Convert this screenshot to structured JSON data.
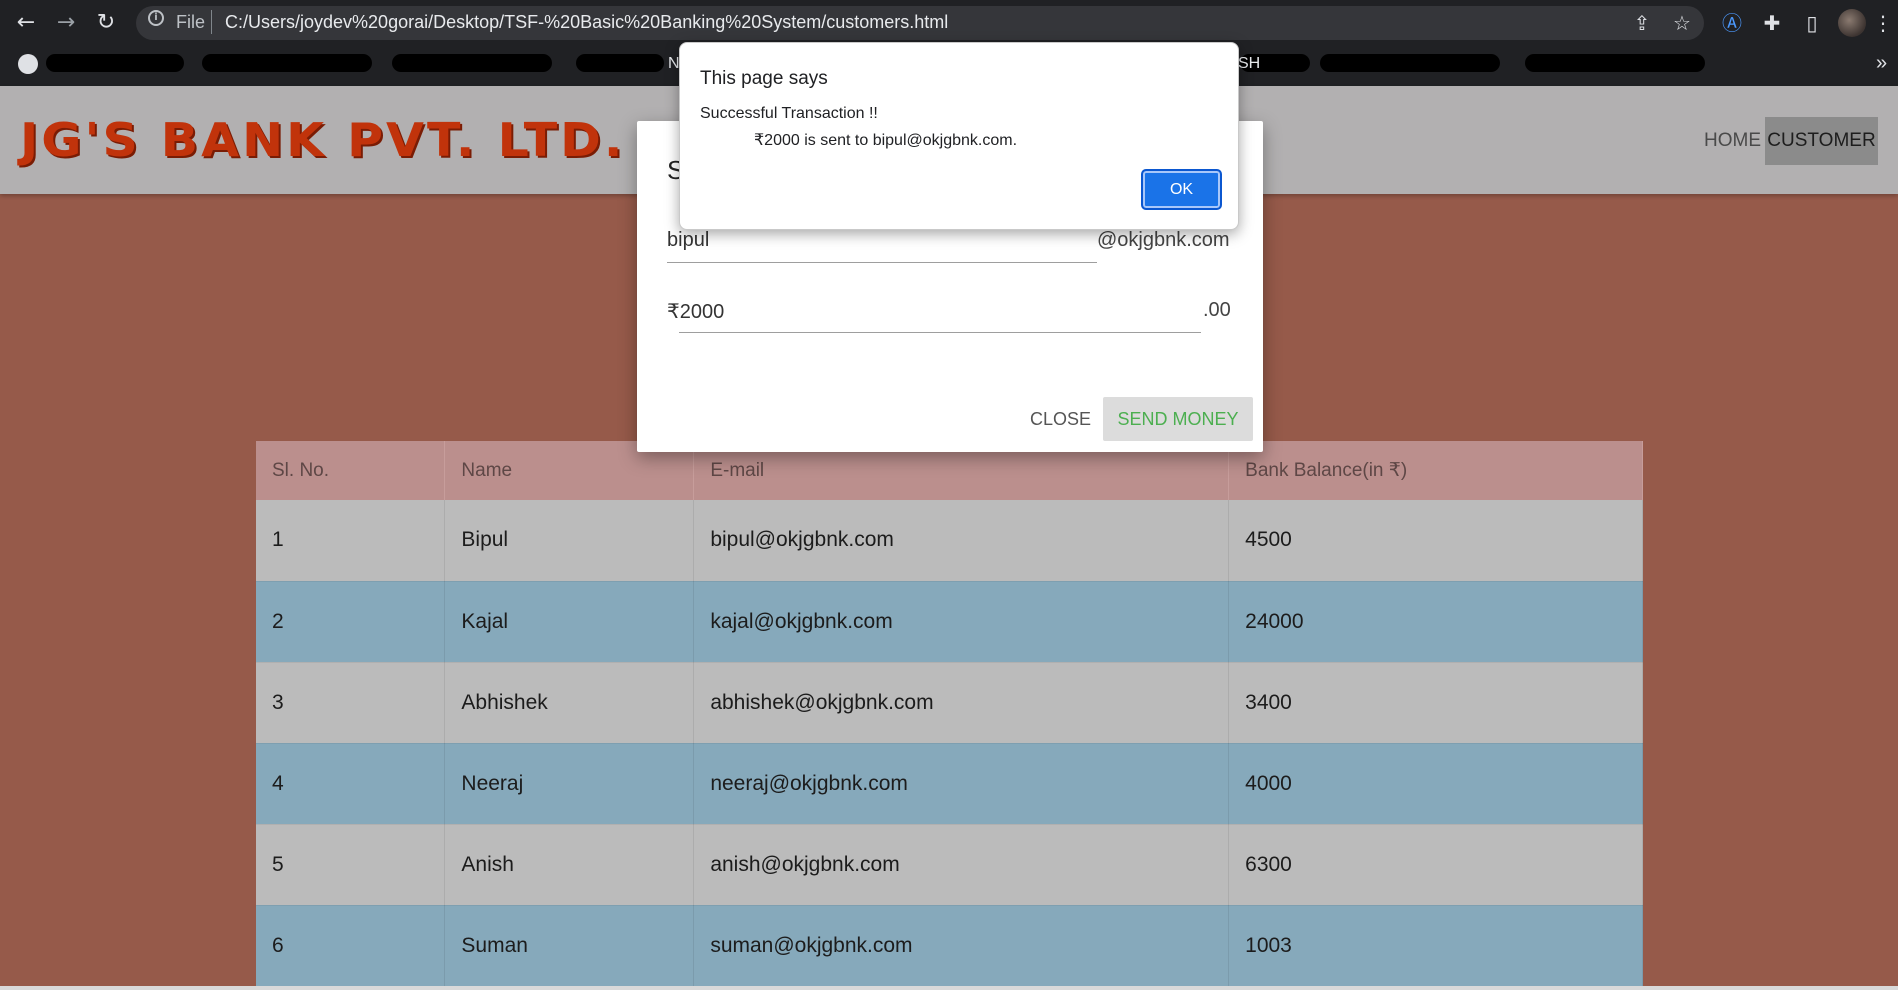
{
  "browser": {
    "file_label": "File",
    "url": "C:/Users/joydev%20gorai/Desktop/TSF-%20Basic%20Banking%20System/customers.html",
    "bookmark_visible_fragments": [
      "N",
      "SH"
    ],
    "more_bookmarks": "»"
  },
  "site": {
    "logo_text": "JG'S BANK PVT. LTD.",
    "nav": {
      "home": "HOME",
      "customer": "CUSTOMER"
    }
  },
  "modal": {
    "title_visible": "S",
    "receiver_value": "bipul",
    "receiver_suffix": "@okjgbnk.com",
    "amount_value": "₹2000",
    "amount_suffix": ".00",
    "close_label": "CLOSE",
    "send_label": "SEND MONEY"
  },
  "alert": {
    "title": "This page says",
    "line1": "Successful Transaction !!",
    "line2": "₹2000 is sent to bipul@okjgbnk.com.",
    "ok_label": "OK"
  },
  "table": {
    "headers": [
      "Sl. No.",
      "Name",
      "E-mail",
      "Bank Balance(in ₹)"
    ],
    "rows": [
      [
        "1",
        "Bipul",
        "bipul@okjgbnk.com",
        "4500"
      ],
      [
        "2",
        "Kajal",
        "kajal@okjgbnk.com",
        "24000"
      ],
      [
        "3",
        "Abhishek",
        "abhishek@okjgbnk.com",
        "3400"
      ],
      [
        "4",
        "Neeraj",
        "neeraj@okjgbnk.com",
        "4000"
      ],
      [
        "5",
        "Anish",
        "anish@okjgbnk.com",
        "6300"
      ],
      [
        "6",
        "Suman",
        "suman@okjgbnk.com",
        "1003"
      ]
    ]
  },
  "colors": {
    "page_bg": "#965a4a",
    "header_bg": "#b2b0b1",
    "logo": "#c1330b",
    "row_odd": "#bbbbbb",
    "row_even": "#86a9bb",
    "table_head": "#bb8f8d",
    "send_text": "#4caf50",
    "ok_button": "#1a73e8"
  }
}
